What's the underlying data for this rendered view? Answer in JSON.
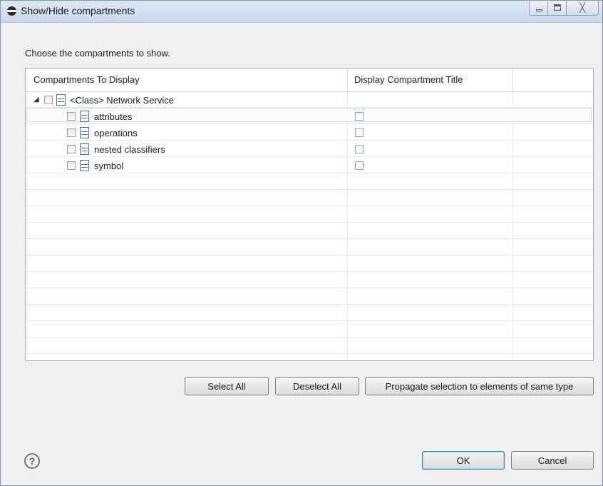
{
  "window": {
    "title": "Show/Hide compartments",
    "controls": {
      "minimize": "–",
      "maximize": "□",
      "close": "╳"
    }
  },
  "instruction": "Choose the compartments to show.",
  "table": {
    "columns": [
      "Compartments To Display",
      "Display Compartment Title"
    ],
    "root": {
      "label": "<Class> Network Service",
      "checked": false,
      "expanded": true,
      "icon": "compartment-icon",
      "expander_icon": "◢"
    },
    "children": [
      {
        "label": "attributes",
        "checked": false,
        "show_title": false,
        "selected": true,
        "icon": "compartment-icon"
      },
      {
        "label": "operations",
        "checked": false,
        "show_title": false,
        "selected": false,
        "icon": "compartment-icon"
      },
      {
        "label": "nested classifiers",
        "checked": false,
        "show_title": false,
        "selected": false,
        "icon": "compartment-icon"
      },
      {
        "label": "symbol",
        "checked": false,
        "show_title": false,
        "selected": false,
        "icon": "compartment-icon"
      }
    ]
  },
  "actions": {
    "select_all": "Select All",
    "deselect_all": "Deselect All",
    "propagate": "Propagate selection to elements of same type"
  },
  "footer": {
    "help_icon": "?",
    "ok": "OK",
    "cancel": "Cancel"
  }
}
